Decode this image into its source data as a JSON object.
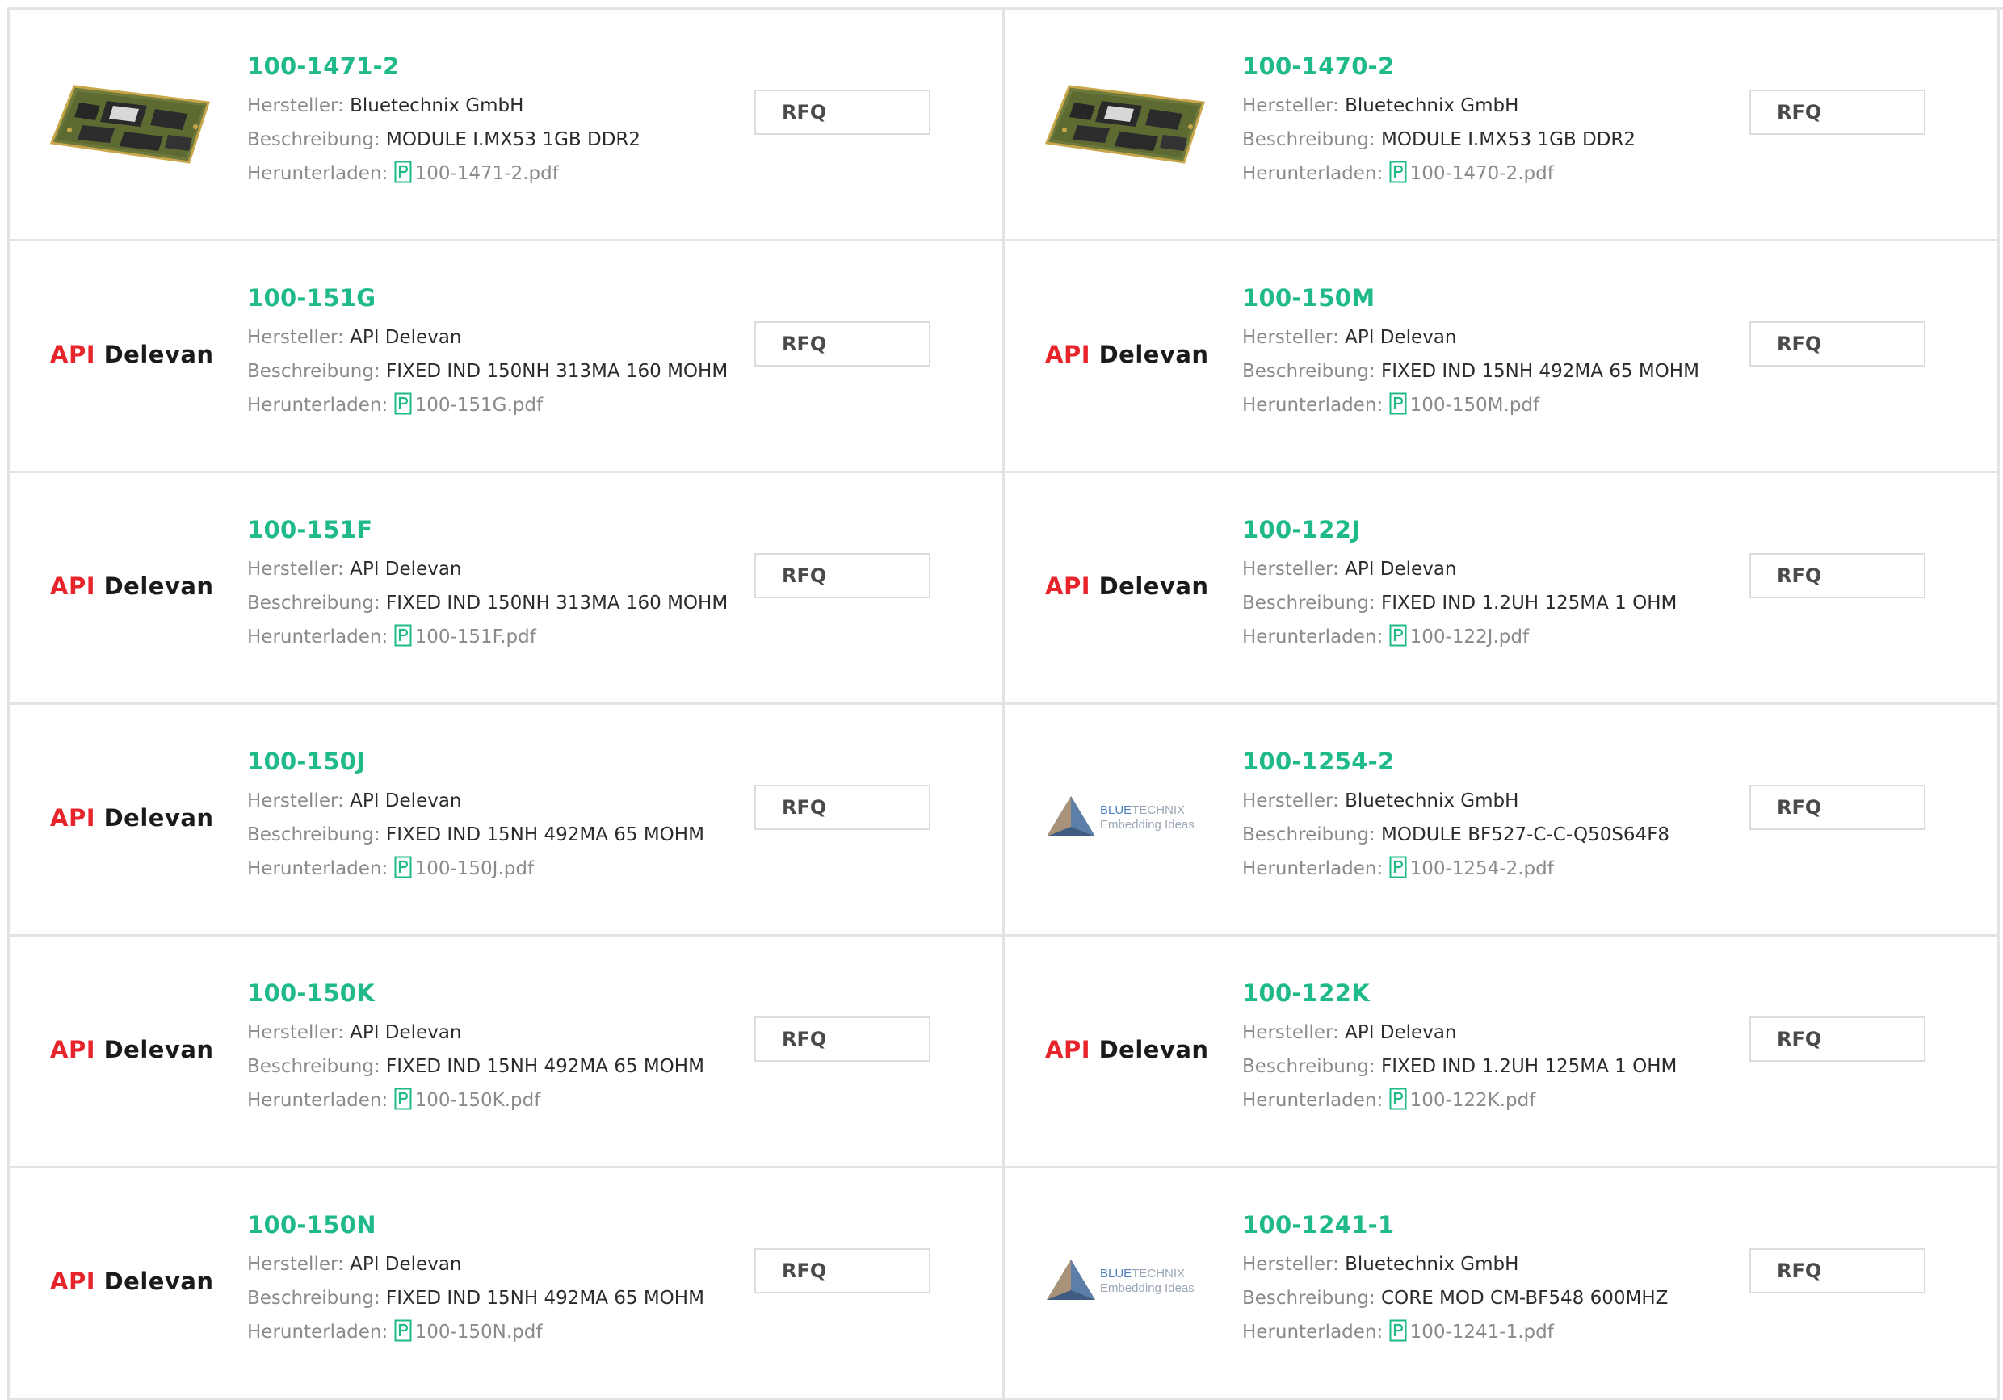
{
  "labels": {
    "manufacturer": "Hersteller:",
    "description": "Beschreibung:",
    "download": "Herunterladen:",
    "rfq": "RFQ"
  },
  "brand_text": {
    "api": "API",
    "delevan": "Delevan",
    "bluetechnix_blue": "BLUE",
    "bluetechnix_technix": "TECHNIX",
    "bluetechnix_tagline": "Embedding Ideas"
  },
  "colors": {
    "part_number": "#1fb98a",
    "api_red": "#e8242b",
    "border": "#e3e3e3",
    "label_gray": "#8a8a8a",
    "pdf_icon": "#1fb98a"
  },
  "products": [
    {
      "part": "100-1471-2",
      "manufacturer": "Bluetechnix GmbH",
      "description": "MODULE I.MX53 1GB DDR2",
      "pdf": "100-1471-2.pdf",
      "image": "pcb-module"
    },
    {
      "part": "100-1470-2",
      "manufacturer": "Bluetechnix GmbH",
      "description": "MODULE I.MX53 1GB DDR2",
      "pdf": "100-1470-2.pdf",
      "image": "pcb-module"
    },
    {
      "part": "100-151G",
      "manufacturer": "API Delevan",
      "description": "FIXED IND 150NH 313MA 160 MOHM",
      "pdf": "100-151G.pdf",
      "image": "api-delevan-logo"
    },
    {
      "part": "100-150M",
      "manufacturer": "API Delevan",
      "description": "FIXED IND 15NH 492MA 65 MOHM",
      "pdf": "100-150M.pdf",
      "image": "api-delevan-logo"
    },
    {
      "part": "100-151F",
      "manufacturer": "API Delevan",
      "description": "FIXED IND 150NH 313MA 160 MOHM",
      "pdf": "100-151F.pdf",
      "image": "api-delevan-logo"
    },
    {
      "part": "100-122J",
      "manufacturer": "API Delevan",
      "description": "FIXED IND 1.2UH 125MA 1 OHM",
      "pdf": "100-122J.pdf",
      "image": "api-delevan-logo"
    },
    {
      "part": "100-150J",
      "manufacturer": "API Delevan",
      "description": "FIXED IND 15NH 492MA 65 MOHM",
      "pdf": "100-150J.pdf",
      "image": "api-delevan-logo"
    },
    {
      "part": "100-1254-2",
      "manufacturer": "Bluetechnix GmbH",
      "description": "MODULE BF527-C-C-Q50S64F8",
      "pdf": "100-1254-2.pdf",
      "image": "bluetechnix-logo"
    },
    {
      "part": "100-150K",
      "manufacturer": "API Delevan",
      "description": "FIXED IND 15NH 492MA 65 MOHM",
      "pdf": "100-150K.pdf",
      "image": "api-delevan-logo"
    },
    {
      "part": "100-122K",
      "manufacturer": "API Delevan",
      "description": "FIXED IND 1.2UH 125MA 1 OHM",
      "pdf": "100-122K.pdf",
      "image": "api-delevan-logo"
    },
    {
      "part": "100-150N",
      "manufacturer": "API Delevan",
      "description": "FIXED IND 15NH 492MA 65 MOHM",
      "pdf": "100-150N.pdf",
      "image": "api-delevan-logo"
    },
    {
      "part": "100-1241-1",
      "manufacturer": "Bluetechnix GmbH",
      "description": "CORE MOD CM-BF548 600MHZ",
      "pdf": "100-1241-1.pdf",
      "image": "bluetechnix-logo"
    }
  ]
}
